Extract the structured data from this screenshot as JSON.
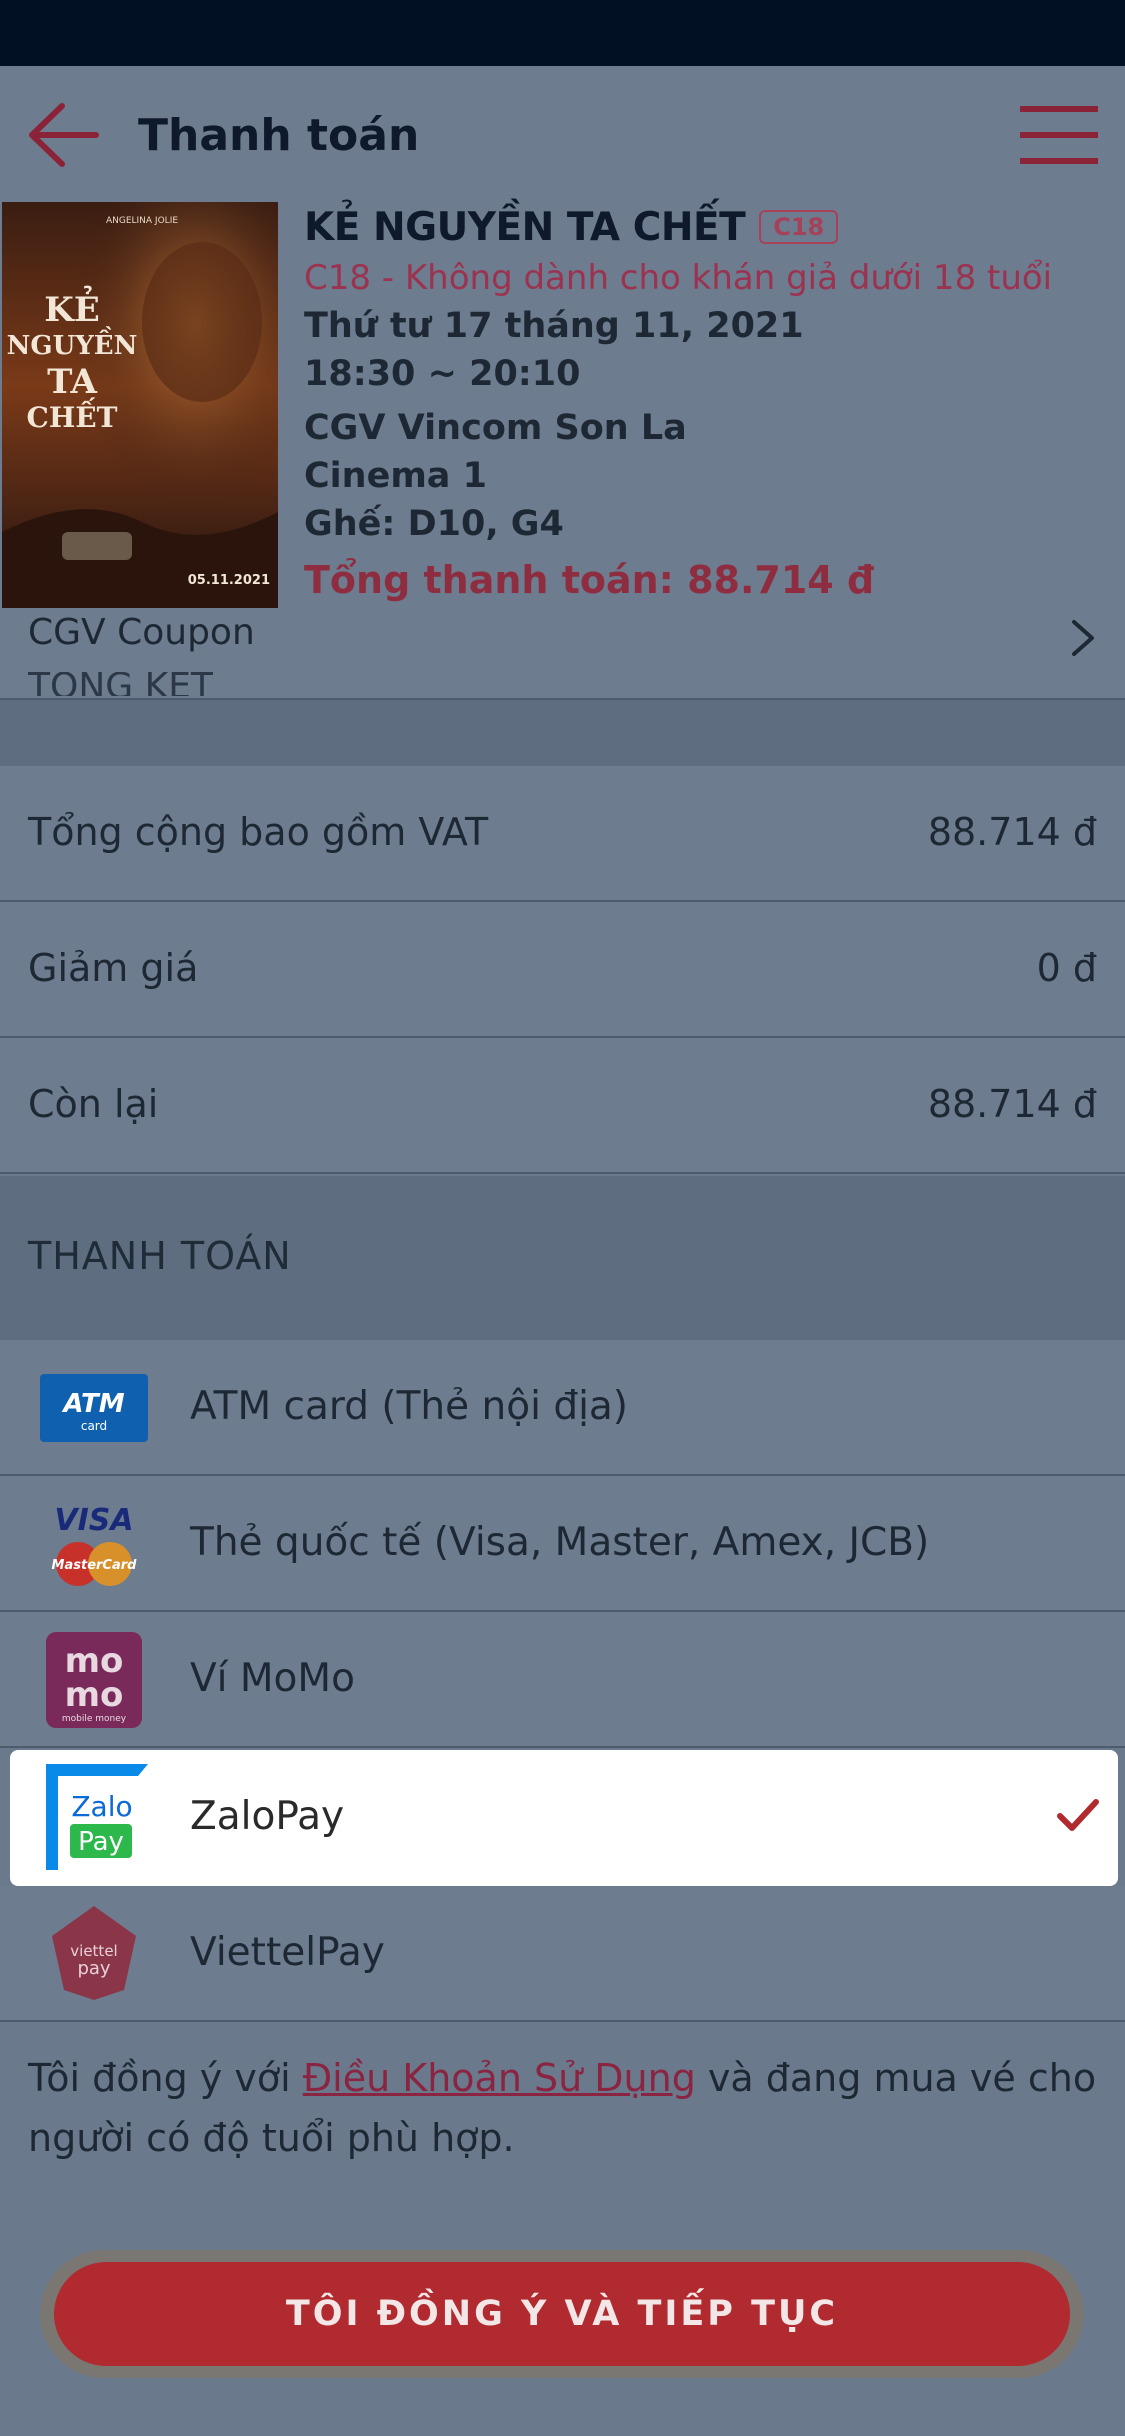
{
  "header": {
    "title": "Thanh toán"
  },
  "movie": {
    "title": "KẺ NGUYỀN TA CHẾT",
    "rating": "C18",
    "rating_note": "C18 - Không dành cho khán giả dưới 18 tuổi",
    "date": "Thứ tư 17 tháng 11, 2021",
    "time": "18:30 ~ 20:10",
    "theater": "CGV Vincom Son La",
    "room": "Cinema 1",
    "seats": "Ghế: D10, G4",
    "total": "Tổng thanh toán: 88.714 đ",
    "poster_text": {
      "line1": "KẺ",
      "line2": "NGUYỀN",
      "line3": "TA",
      "line4": "CHẾT",
      "cast": "ANGELINA JOLIE",
      "date": "05.11.2021"
    }
  },
  "coupon": {
    "label": "CGV Coupon",
    "section_peek": "TỔNG KẾT"
  },
  "summary": [
    {
      "label": "Tổng cộng bao gồm VAT",
      "value": "88.714 đ"
    },
    {
      "label": "Giảm giá",
      "value": "0 đ"
    },
    {
      "label": "Còn lại",
      "value": "88.714 đ"
    }
  ],
  "payment": {
    "header": "THANH TOÁN",
    "selected": "ZaloPay",
    "methods": [
      {
        "label": "ATM card (Thẻ nội địa)",
        "icon": "atm-card-icon",
        "logo_text": "ATM",
        "logo_sub": "card"
      },
      {
        "label": "Thẻ quốc tế (Visa, Master, Amex, JCB)",
        "icon": "visa-mastercard-icon",
        "logo_text": "VISA",
        "logo_sub": "MasterCard"
      },
      {
        "label": "Ví MoMo",
        "icon": "momo-icon",
        "logo_text": "mo",
        "logo_text2": "mo",
        "logo_sub": "mobile money"
      },
      {
        "label": "ZaloPay",
        "icon": "zalopay-icon",
        "logo_text": "Zalo",
        "logo_text2": "Pay"
      },
      {
        "label": "ViettelPay",
        "icon": "viettelpay-icon",
        "logo_text": "viettel",
        "logo_text2": "pay"
      }
    ]
  },
  "consent": {
    "before": "Tôi đồng ý với ",
    "link": "Điều Khoản Sử Dụng",
    "after": " và đang mua vé cho người có độ tuổi phù hợp."
  },
  "cta": {
    "label": "TÔI ĐỒNG Ý VÀ TIẾP TỤC"
  },
  "colors": {
    "accent": "#b12a30",
    "dim_overlay": "#6d7c8e",
    "status_bar": "#011022"
  }
}
